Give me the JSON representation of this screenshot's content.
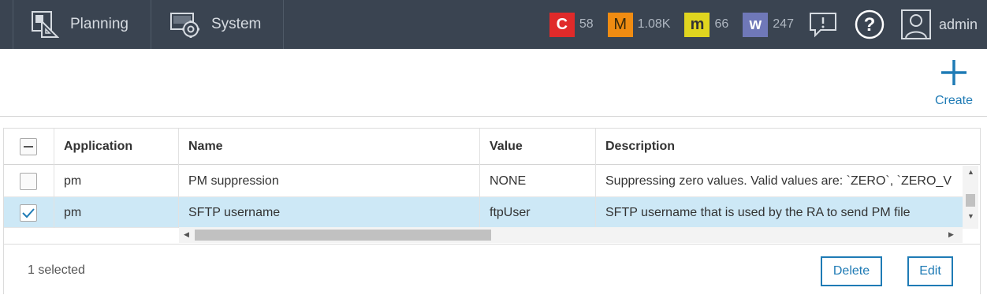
{
  "nav": {
    "items": [
      {
        "label": "Planning",
        "icon": "planning-icon"
      },
      {
        "label": "System",
        "icon": "system-gear-icon"
      }
    ]
  },
  "alarms": [
    {
      "letter": "C",
      "count": "58",
      "color": "#e02a2a"
    },
    {
      "letter": "M",
      "count": "1.08K",
      "color": "#f08c12"
    },
    {
      "letter": "m",
      "count": "66",
      "color": "#e0d51f"
    },
    {
      "letter": "w",
      "count": "247",
      "color": "#6f78b8"
    }
  ],
  "user": {
    "name": "admin"
  },
  "toolbar": {
    "create_label": "Create"
  },
  "table": {
    "columns": [
      "Application",
      "Name",
      "Value",
      "Description"
    ],
    "rows": [
      {
        "application": "pm",
        "name": "PM suppression",
        "value": "NONE",
        "description": "Suppressing zero values. Valid values are: `ZERO`, `ZERO_V",
        "checked": false
      },
      {
        "application": "pm",
        "name": "SFTP username",
        "value": "ftpUser",
        "description": "SFTP username that is used by the RA to send PM file",
        "checked": true
      }
    ]
  },
  "footer": {
    "selected_text": "1 selected",
    "delete_label": "Delete",
    "edit_label": "Edit"
  },
  "colors": {
    "topbar": "#3a4451",
    "accent": "#1f7bb5",
    "selected_row": "#cde8f6"
  }
}
